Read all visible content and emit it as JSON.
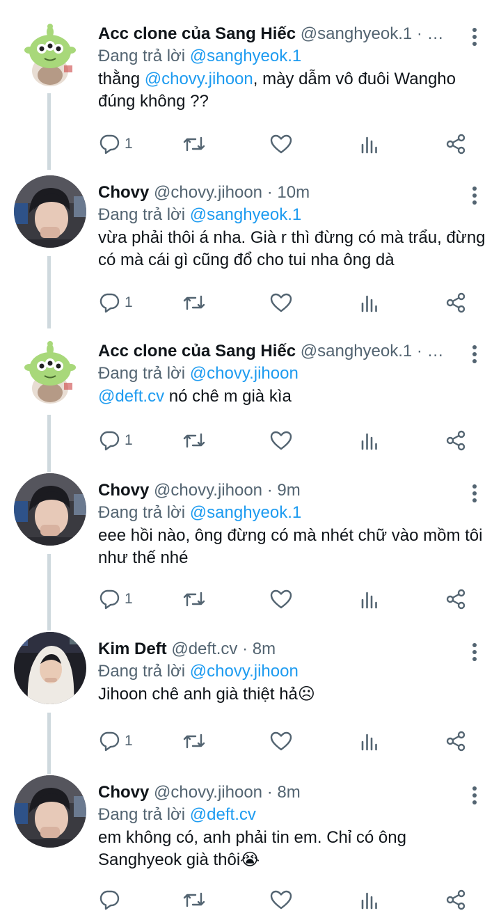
{
  "tweets": [
    {
      "avatar": "alien-plush-avatar",
      "name": "Acc clone của Sang Hiếc",
      "handle": "@sanghyeok.1",
      "dot": "·",
      "time": "…",
      "reply_prefix": "Đang trả lời",
      "reply_to": "@sanghyeok.1",
      "body_parts": [
        {
          "text": "thằng ",
          "mention": false
        },
        {
          "text": "@chovy.jihoon",
          "mention": true
        },
        {
          "text": ", mày dẫm vô đuôi Wangho đúng không ??",
          "mention": false
        }
      ],
      "reply_count": "1"
    },
    {
      "avatar": "chovy-avatar",
      "name": "Chovy",
      "handle": "@chovy.jihoon",
      "dot": "·",
      "time": "10m",
      "reply_prefix": "Đang trả lời",
      "reply_to": "@sanghyeok.1",
      "body_parts": [
        {
          "text": "vừa phải thôi á nha. Già r thì đừng có mà trẩu, đừng có mà cái gì cũng đổ cho tui nha ông dà",
          "mention": false
        }
      ],
      "reply_count": "1"
    },
    {
      "avatar": "alien-plush-avatar",
      "name": "Acc clone của Sang Hiếc",
      "handle": "@sanghyeok.1",
      "dot": "·",
      "time": "…",
      "reply_prefix": "Đang trả lời",
      "reply_to": "@chovy.jihoon",
      "body_parts": [
        {
          "text": "@deft.cv",
          "mention": true
        },
        {
          "text": " nó chê m già kìa",
          "mention": false
        }
      ],
      "reply_count": "1"
    },
    {
      "avatar": "chovy-avatar",
      "name": "Chovy",
      "handle": "@chovy.jihoon",
      "dot": "·",
      "time": "9m",
      "reply_prefix": "Đang trả lời",
      "reply_to": "@sanghyeok.1",
      "body_parts": [
        {
          "text": "eee hồi nào, ông đừng có mà nhét chữ vào mồm tôi như thế nhé",
          "mention": false
        }
      ],
      "reply_count": "1"
    },
    {
      "avatar": "deft-avatar",
      "name": "Kim Deft",
      "handle": "@deft.cv",
      "dot": "·",
      "time": "8m",
      "reply_prefix": "Đang trả lời",
      "reply_to": "@chovy.jihoon",
      "body_parts": [
        {
          "text": "Jihoon chê anh già thiệt hả☹",
          "mention": false
        }
      ],
      "reply_count": "1"
    },
    {
      "avatar": "chovy-avatar",
      "name": "Chovy",
      "handle": "@chovy.jihoon",
      "dot": "·",
      "time": "8m",
      "reply_prefix": "Đang trả lời",
      "reply_to": "@deft.cv",
      "body_parts": [
        {
          "text": "em không có, anh phải tin em. Chỉ có ông Sanghyeok già thôi😭",
          "mention": false
        }
      ],
      "reply_count": ""
    }
  ],
  "colors": {
    "text": "#0f1419",
    "secondary": "#536471",
    "mention": "#1d9bf0",
    "thread_line": "#cfd9de"
  },
  "icons": {
    "reply": "reply-icon",
    "retweet": "retweet-icon",
    "like": "heart-icon",
    "views": "analytics-icon",
    "share": "share-icon",
    "more": "more-options-icon"
  }
}
